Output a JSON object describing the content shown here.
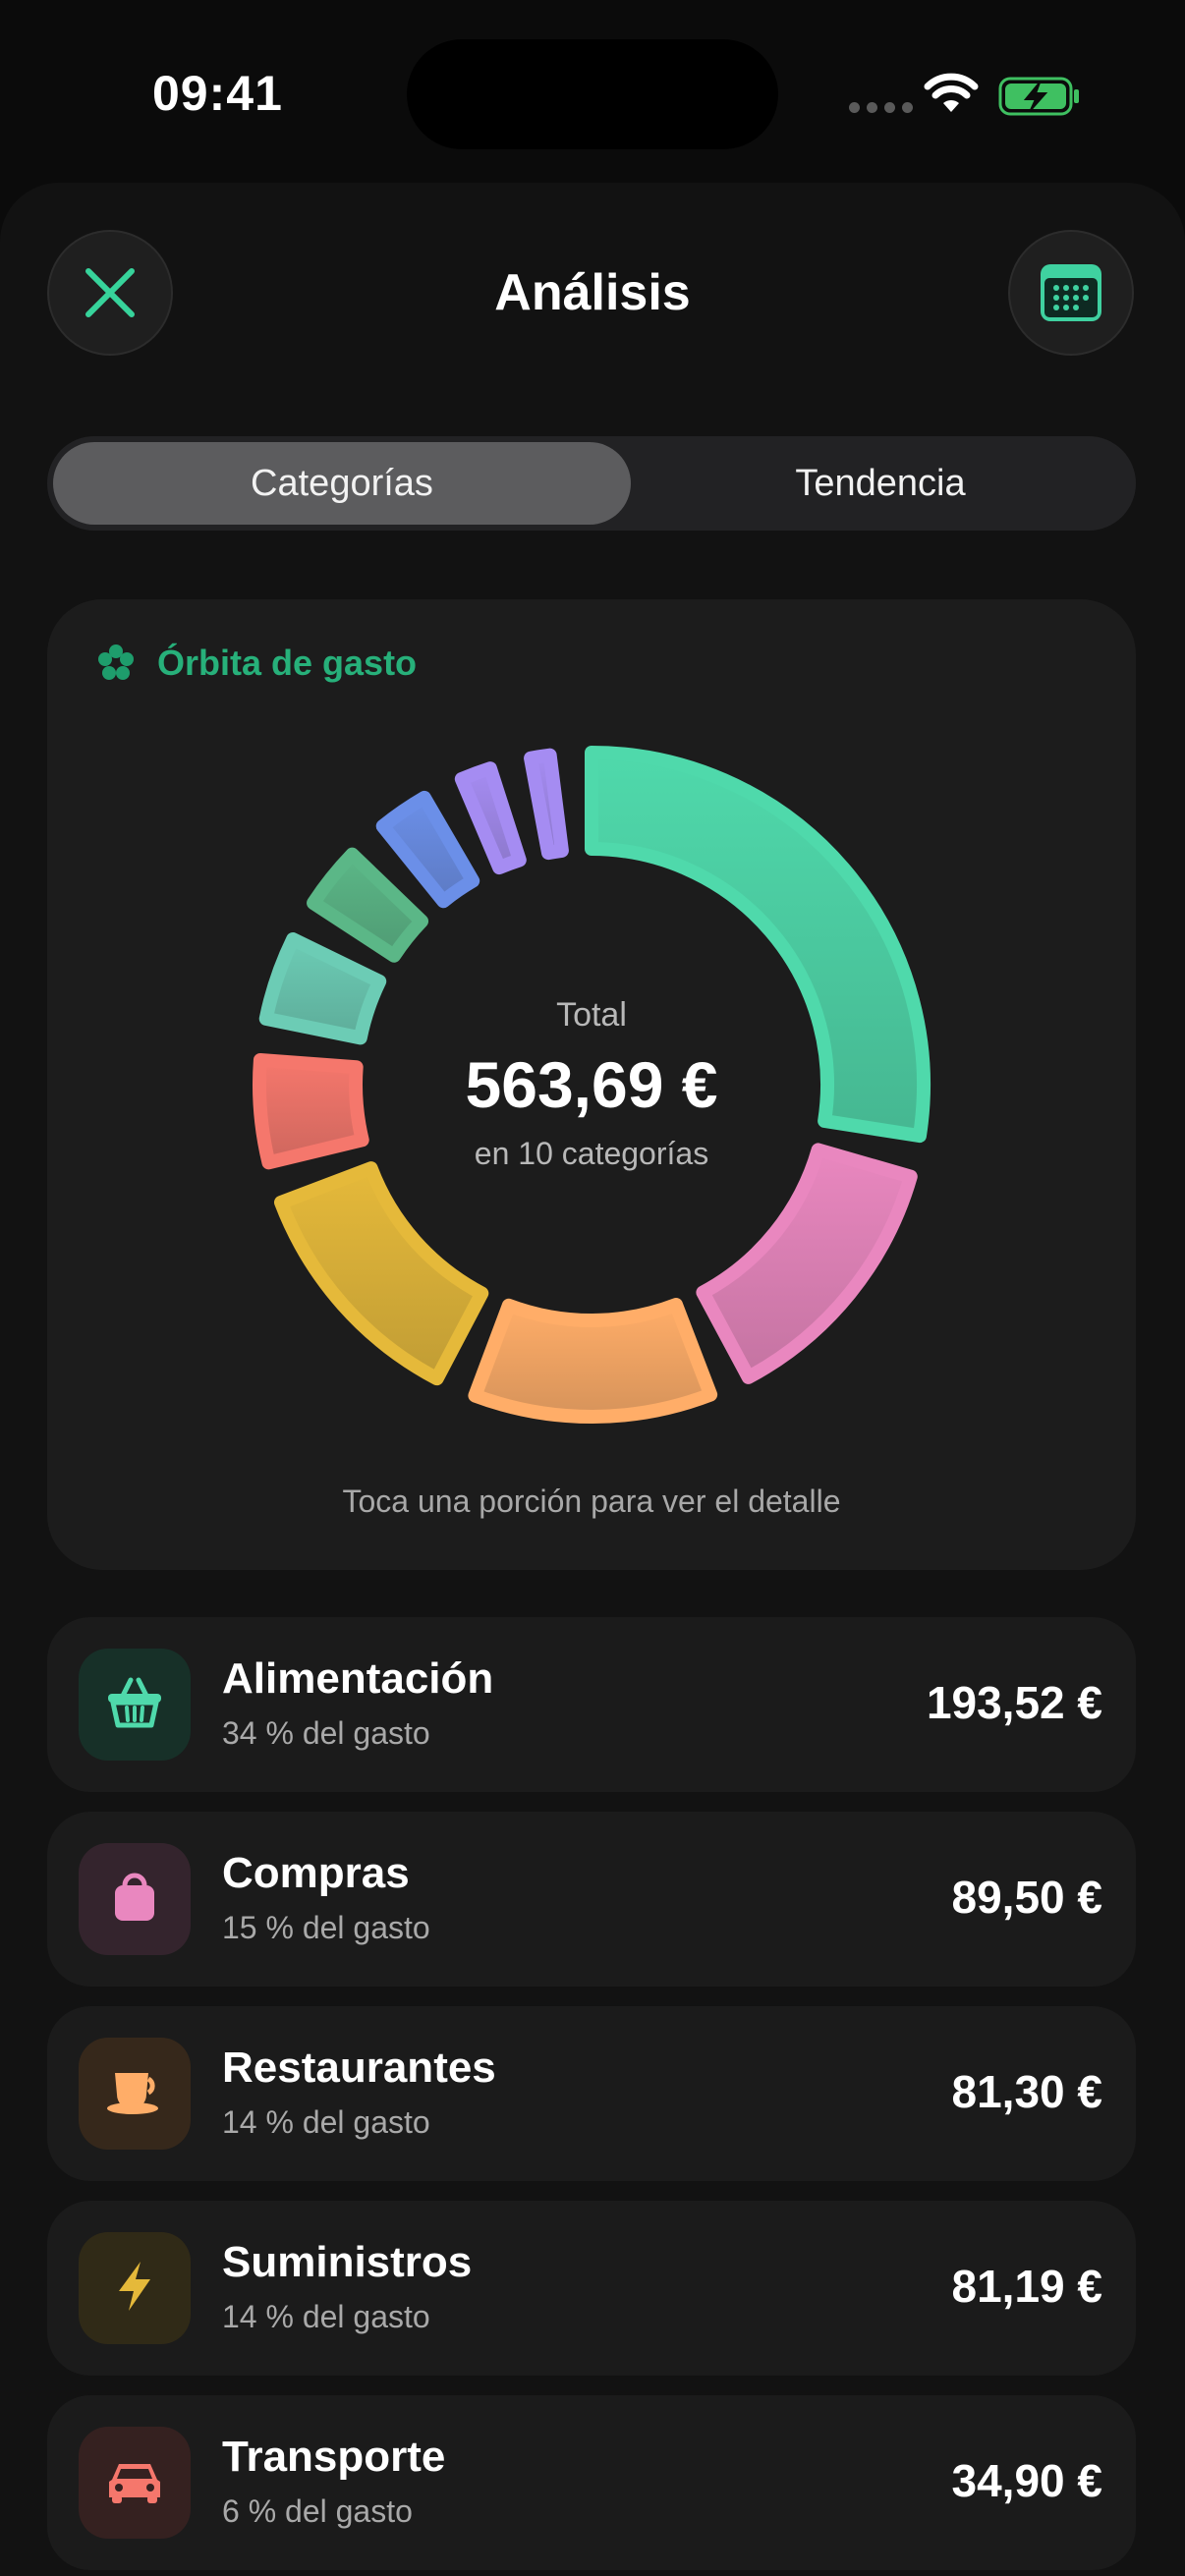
{
  "status_bar": {
    "time": "09:41"
  },
  "header": {
    "title": "Análisis",
    "close_icon": "close-icon",
    "calendar_icon": "calendar-icon"
  },
  "tabs": [
    {
      "label": "Categorías",
      "selected": true
    },
    {
      "label": "Tendencia",
      "selected": false
    }
  ],
  "orbit_card": {
    "title": "Órbita de gasto",
    "total_label": "Total",
    "total_amount": "563,69 €",
    "subtitle": "en 10 categorías",
    "hint": "Toca una porción para ver el detalle"
  },
  "chart_data": {
    "type": "pie",
    "categories": [
      "Alimentación",
      "Compras",
      "Restaurantes",
      "Suministros",
      "Transporte",
      "",
      "",
      "",
      "",
      ""
    ],
    "values": [
      193.52,
      89.5,
      81.3,
      81.19,
      34.9,
      28.4,
      21.0,
      17.0,
      10.3,
      6.58
    ],
    "colors": [
      "#4fd9ab",
      "#e987bf",
      "#ffad68",
      "#e5b93a",
      "#f5776c",
      "#6cccb5",
      "#5bb787",
      "#6b8fe8",
      "#a58cf2",
      "#a58cf2"
    ]
  },
  "categories": [
    {
      "name": "Alimentación",
      "percent": "34 % del gasto",
      "amount": "193,52 €",
      "icon": "basket-icon",
      "color": "#4fd9ab",
      "bg": "#173028"
    },
    {
      "name": "Compras",
      "percent": "15 % del gasto",
      "amount": "89,50 €",
      "icon": "shopping-bag-icon",
      "color": "#e987bf",
      "bg": "#34242d"
    },
    {
      "name": "Restaurantes",
      "percent": "14 % del gasto",
      "amount": "81,30 €",
      "icon": "coffee-cup-icon",
      "color": "#ffad68",
      "bg": "#36281b"
    },
    {
      "name": "Suministros",
      "percent": "14 % del gasto",
      "amount": "81,19 €",
      "icon": "bolt-icon",
      "color": "#e5b93a",
      "bg": "#302a17"
    },
    {
      "name": "Transporte",
      "percent": "6 % del gasto",
      "amount": "34,90 €",
      "icon": "car-icon",
      "color": "#f5776c",
      "bg": "#352120"
    }
  ]
}
